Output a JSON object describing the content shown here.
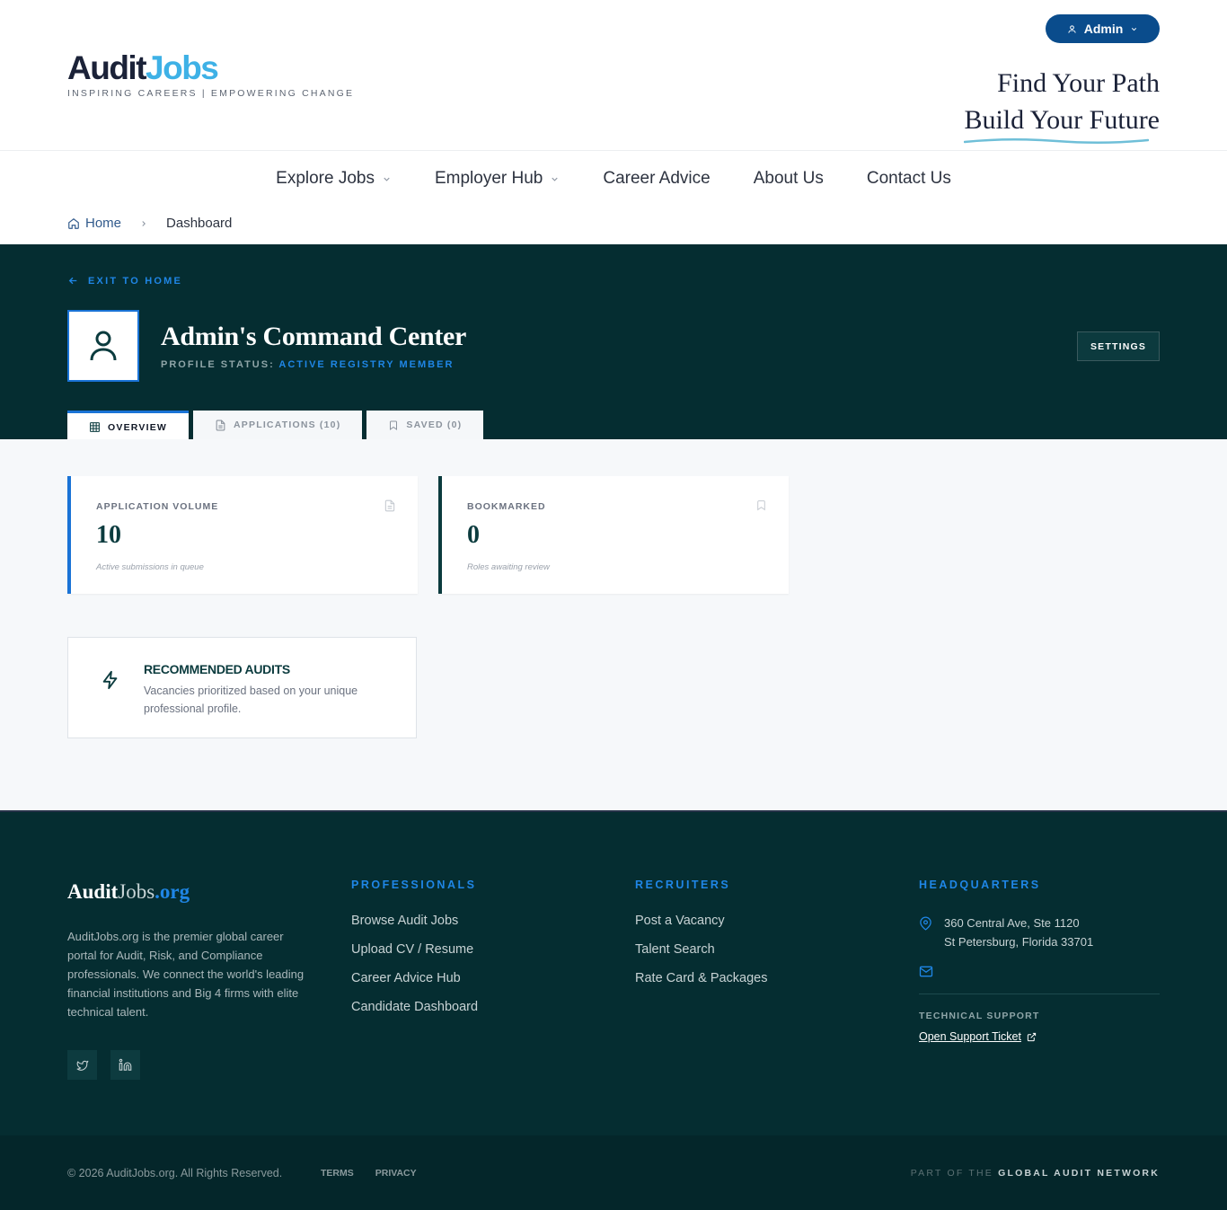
{
  "header": {
    "logo_part1": "Audit",
    "logo_part2": "Jobs",
    "tagline": "INSPIRING CAREERS | EMPOWERING CHANGE",
    "user_button": "Admin",
    "slogan_line1": "Find Your Path",
    "slogan_line2": "Build Your Future"
  },
  "nav": {
    "items": [
      {
        "label": "Explore Jobs",
        "dropdown": true
      },
      {
        "label": "Employer Hub",
        "dropdown": true
      },
      {
        "label": "Career Advice",
        "dropdown": false
      },
      {
        "label": "About Us",
        "dropdown": false
      },
      {
        "label": "Contact Us",
        "dropdown": false
      }
    ]
  },
  "breadcrumb": {
    "home": "Home",
    "current": "Dashboard"
  },
  "hero": {
    "exit_label": "EXIT TO HOME",
    "title": "Admin's Command Center",
    "status_label": "PROFILE STATUS:",
    "status_value": "ACTIVE REGISTRY MEMBER",
    "settings_label": "SETTINGS"
  },
  "tabs": [
    {
      "label": "OVERVIEW",
      "icon": "grid-icon",
      "active": true
    },
    {
      "label": "APPLICATIONS (10)",
      "icon": "document-icon",
      "active": false
    },
    {
      "label": "SAVED (0)",
      "icon": "bookmark-icon",
      "active": false
    }
  ],
  "stats": [
    {
      "label": "APPLICATION VOLUME",
      "value": "10",
      "sub": "Active submissions in queue",
      "icon": "document-icon"
    },
    {
      "label": "BOOKMARKED",
      "value": "0",
      "sub": "Roles awaiting review",
      "icon": "bookmark-icon"
    }
  ],
  "recommended": {
    "title": "RECOMMENDED AUDITS",
    "description": "Vacancies prioritized based on your unique professional profile."
  },
  "footer": {
    "logo_part1": "Audit",
    "logo_part2": "Jobs",
    "logo_part3": ".org",
    "description": "AuditJobs.org is the premier global career portal for Audit, Risk, and Compliance professionals. We connect the world's leading financial institutions and Big 4 firms with elite technical talent.",
    "professionals_title": "PROFESSIONALS",
    "professionals_links": [
      "Browse Audit Jobs",
      "Upload CV / Resume",
      "Career Advice Hub",
      "Candidate Dashboard"
    ],
    "recruiters_title": "RECRUITERS",
    "recruiters_links": [
      "Post a Vacancy",
      "Talent Search",
      "Rate Card & Packages"
    ],
    "hq_title": "HEADQUARTERS",
    "address_line1": "360 Central Ave, Ste 1120",
    "address_line2": "St Petersburg, Florida 33701",
    "tech_support_label": "TECHNICAL SUPPORT",
    "ticket_link": "Open Support Ticket",
    "copyright": "© 2026 AuditJobs.org. All Rights Reserved.",
    "terms": "TERMS",
    "privacy": "PRIVACY",
    "network_prefix": "PART OF THE",
    "network_name": "GLOBAL AUDIT NETWORK"
  },
  "colors": {
    "primary_dark": "#052d31",
    "accent_blue": "#1a73d6",
    "logo_light_blue": "#3eb1e6",
    "button_blue": "#0a4c8c"
  }
}
